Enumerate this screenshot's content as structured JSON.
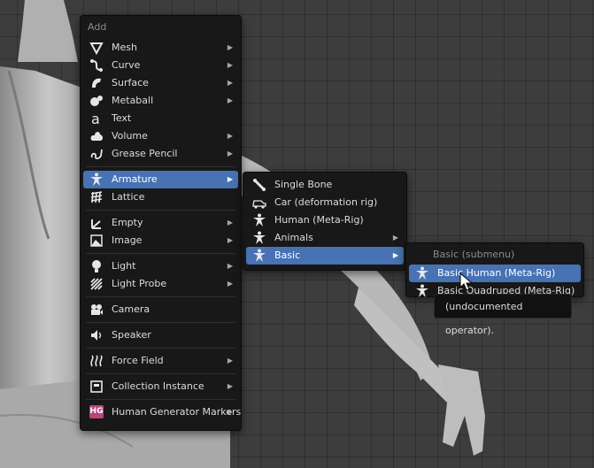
{
  "add_menu": {
    "header": "Add",
    "items": [
      {
        "label": "Mesh",
        "icon": "mesh-icon",
        "submenu": true
      },
      {
        "label": "Curve",
        "icon": "curve-icon",
        "submenu": true
      },
      {
        "label": "Surface",
        "icon": "surface-icon",
        "submenu": true
      },
      {
        "label": "Metaball",
        "icon": "metaball-icon",
        "submenu": true
      },
      {
        "label": "Text",
        "icon": "text-icon",
        "submenu": false
      },
      {
        "label": "Volume",
        "icon": "volume-icon",
        "submenu": true
      },
      {
        "label": "Grease Pencil",
        "icon": "grease-pencil-icon",
        "submenu": true
      },
      {
        "label": "Armature",
        "icon": "armature-icon",
        "submenu": true,
        "active": true
      },
      {
        "label": "Lattice",
        "icon": "lattice-icon",
        "submenu": false
      },
      {
        "label": "Empty",
        "icon": "empty-icon",
        "submenu": true
      },
      {
        "label": "Image",
        "icon": "image-icon",
        "submenu": true
      },
      {
        "label": "Light",
        "icon": "light-icon",
        "submenu": true
      },
      {
        "label": "Light Probe",
        "icon": "light-probe-icon",
        "submenu": true
      },
      {
        "label": "Camera",
        "icon": "camera-icon",
        "submenu": false
      },
      {
        "label": "Speaker",
        "icon": "speaker-icon",
        "submenu": false
      },
      {
        "label": "Force Field",
        "icon": "force-field-icon",
        "submenu": true
      },
      {
        "label": "Collection Instance",
        "icon": "collection-icon",
        "submenu": true
      },
      {
        "label": "Human Generator Markers",
        "icon": "hg-icon",
        "submenu": true
      }
    ]
  },
  "armature_menu": {
    "items": [
      {
        "label": "Single Bone",
        "icon": "bone-icon",
        "submenu": false
      },
      {
        "label": "Car (deformation rig)",
        "icon": "car-icon",
        "submenu": false
      },
      {
        "label": "Human (Meta-Rig)",
        "icon": "armature-icon",
        "submenu": false
      },
      {
        "label": "Animals",
        "icon": "armature-icon",
        "submenu": true
      },
      {
        "label": "Basic",
        "icon": "armature-icon",
        "submenu": true,
        "active": true
      }
    ]
  },
  "basic_menu": {
    "header": "Basic (submenu)",
    "items": [
      {
        "label": "Basic Human (Meta-Rig)",
        "icon": "armature-icon",
        "active": true
      },
      {
        "label": "Basic Quadruped (Meta-Rig)",
        "icon": "armature-icon"
      }
    ]
  },
  "tooltip": {
    "text": "(undocumented operator)."
  },
  "hg_badge_text": "HG",
  "colors": {
    "highlight": "#4772b3",
    "menu_bg": "#181818",
    "viewport_bg": "#3d3d3d",
    "hg_badge": "#b9447c"
  }
}
